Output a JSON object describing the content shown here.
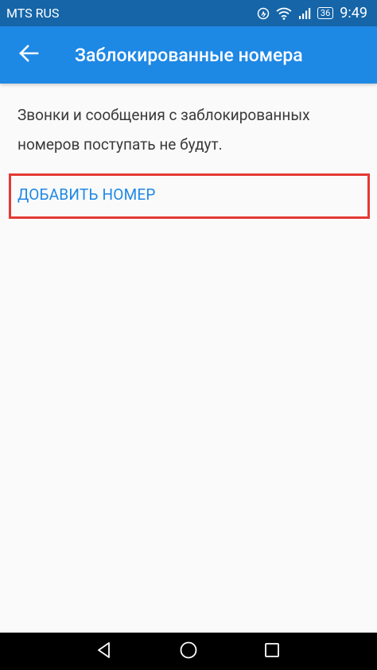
{
  "status_bar": {
    "carrier": "MTS RUS",
    "battery": "36",
    "time": "9:49",
    "icons": [
      "data-saver-icon",
      "wifi-icon",
      "signal-icon",
      "battery-icon"
    ]
  },
  "app_bar": {
    "back_icon": "arrow-back-icon",
    "title": "Заблокированные номера"
  },
  "content": {
    "description": "Звонки и сообщения с заблокированных номеров поступать не будут.",
    "add_number_label": "ДОБАВИТЬ НОМЕР",
    "highlight_color": "#e53935"
  },
  "nav_bar": {
    "icons": [
      "back-triangle-icon",
      "home-circle-icon",
      "recents-square-icon"
    ]
  },
  "colors": {
    "status_bar": "#1565a8",
    "app_bar": "#1e88e5",
    "accent": "#1e88e5",
    "background": "#fafafa"
  }
}
